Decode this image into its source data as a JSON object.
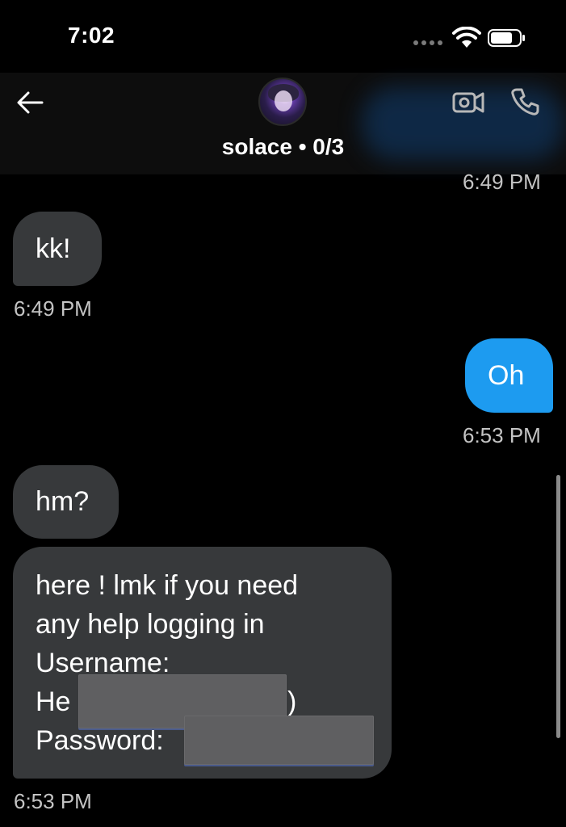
{
  "status": {
    "time": "7:02"
  },
  "header": {
    "title": "solace • 0/3"
  },
  "messages": {
    "top_timestamp": "6:49 PM",
    "m1": {
      "text": "kk!",
      "time": "6:49 PM"
    },
    "m2": {
      "text": "Oh",
      "time": "6:53 PM"
    },
    "m3": {
      "text": "hm?"
    },
    "m4": {
      "line1": "here ! lmk if you need",
      "line2": "any help logging in",
      "line3": "Username:",
      "line4": "He",
      "line4_end": ")",
      "line5": "Password:",
      "time": "6:53 PM"
    }
  },
  "colors": {
    "outgoing": "#1d9bf0",
    "incoming": "#37393b",
    "background": "#000000"
  }
}
